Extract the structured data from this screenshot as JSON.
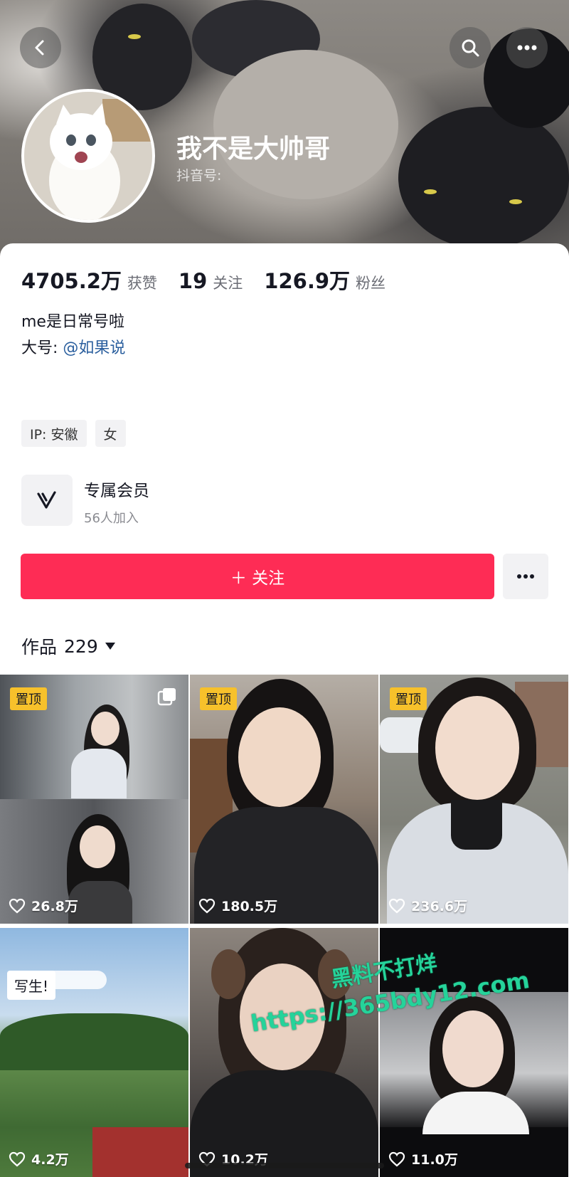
{
  "profile": {
    "display_name": "我不是大帅哥",
    "douyin_id_label": "抖音号:"
  },
  "stats": [
    {
      "value": "4705.2万",
      "label": "获赞"
    },
    {
      "value": "19",
      "label": "关注"
    },
    {
      "value": "126.9万",
      "label": "粉丝"
    }
  ],
  "bio": {
    "line1": "me是日常号啦",
    "line2_prefix": "大号:",
    "line2_link": "@如果说"
  },
  "tags": [
    "IP: 安徽",
    "女"
  ],
  "membership": {
    "title": "专属会员",
    "subtitle": "56人加入"
  },
  "follow_button_label": "＋ 关注",
  "works": {
    "label": "作品",
    "count": "229"
  },
  "grid": [
    {
      "pinned": true,
      "pin_label": "置顶",
      "likes": "26.8万"
    },
    {
      "pinned": true,
      "pin_label": "置顶",
      "likes": "180.5万"
    },
    {
      "pinned": true,
      "pin_label": "置顶",
      "likes": "236.6万"
    },
    {
      "pinned": false,
      "sticker": "写生!",
      "likes": "4.2万"
    },
    {
      "pinned": false,
      "likes": "10.2万"
    },
    {
      "pinned": false,
      "likes": "11.0万"
    }
  ],
  "watermark": {
    "line1": "黑料不打烊",
    "line2": "https://365bdy12.com"
  },
  "icons": [
    "back-icon",
    "search-icon",
    "more-icon",
    "vip-v-icon",
    "heart-icon",
    "multi-image-icon",
    "dropdown-caret-icon"
  ],
  "colors": {
    "accent": "#fe2c55",
    "link": "#2b5f9e",
    "pin_badge": "#f7c12b",
    "watermark": "#25d39a"
  }
}
